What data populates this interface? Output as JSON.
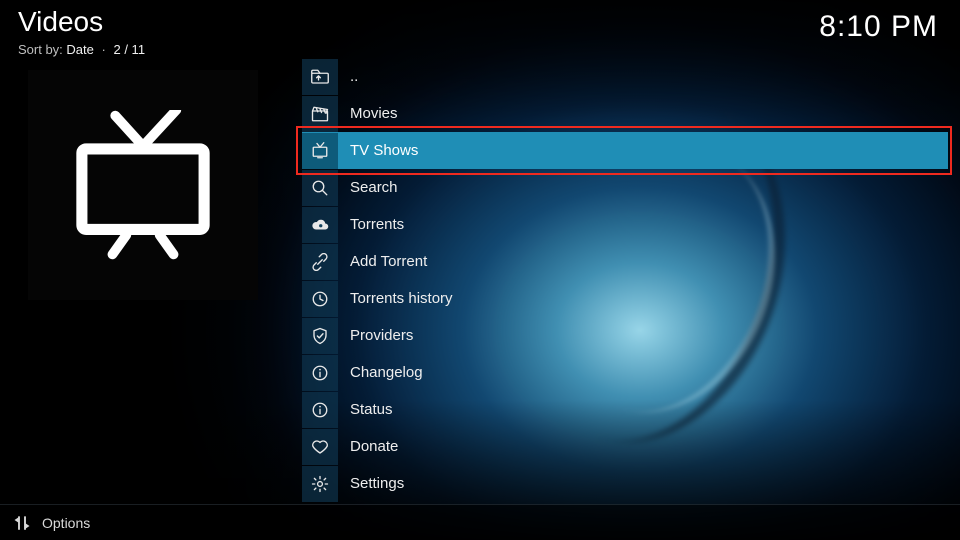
{
  "header": {
    "title": "Videos",
    "sort_label": "Sort by:",
    "sort_key": "Date",
    "position": "2 / 11"
  },
  "clock": "8:10 PM",
  "list": {
    "items": [
      {
        "id": "up",
        "label": "..",
        "icon": "folder-up-icon"
      },
      {
        "id": "movies",
        "label": "Movies",
        "icon": "clapperboard-icon"
      },
      {
        "id": "tvshows",
        "label": "TV Shows",
        "icon": "tv-icon",
        "selected": true
      },
      {
        "id": "search",
        "label": "Search",
        "icon": "search-icon"
      },
      {
        "id": "torrents",
        "label": "Torrents",
        "icon": "cloud-icon"
      },
      {
        "id": "addtorrent",
        "label": "Add Torrent",
        "icon": "link-icon"
      },
      {
        "id": "torrentshistory",
        "label": "Torrents history",
        "icon": "clock-icon"
      },
      {
        "id": "providers",
        "label": "Providers",
        "icon": "shield-icon"
      },
      {
        "id": "changelog",
        "label": "Changelog",
        "icon": "info-icon"
      },
      {
        "id": "status",
        "label": "Status",
        "icon": "info-icon"
      },
      {
        "id": "donate",
        "label": "Donate",
        "icon": "heart-icon"
      },
      {
        "id": "settings",
        "label": "Settings",
        "icon": "gear-icon"
      }
    ]
  },
  "footer": {
    "options_label": "Options"
  }
}
